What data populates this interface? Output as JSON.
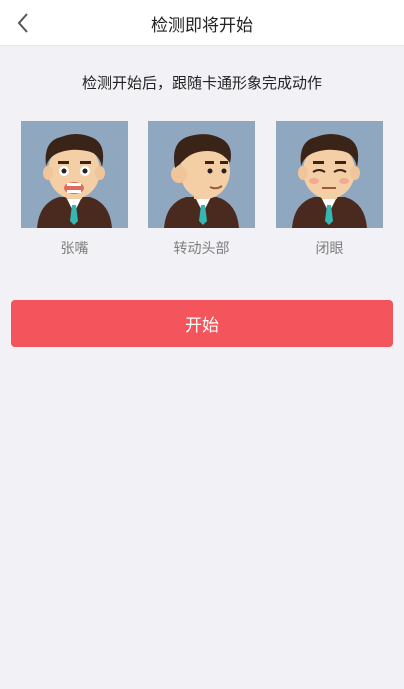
{
  "header": {
    "title": "检测即将开始"
  },
  "main": {
    "instruction": "检测开始后，跟随卡通形象完成动作",
    "actions": [
      {
        "label": "张嘴"
      },
      {
        "label": "转动头部"
      },
      {
        "label": "闭眼"
      }
    ],
    "start_label": "开始"
  },
  "colors": {
    "accent": "#f4545b",
    "background": "#f2f1f5",
    "card_bg": "#8fa7bf"
  }
}
